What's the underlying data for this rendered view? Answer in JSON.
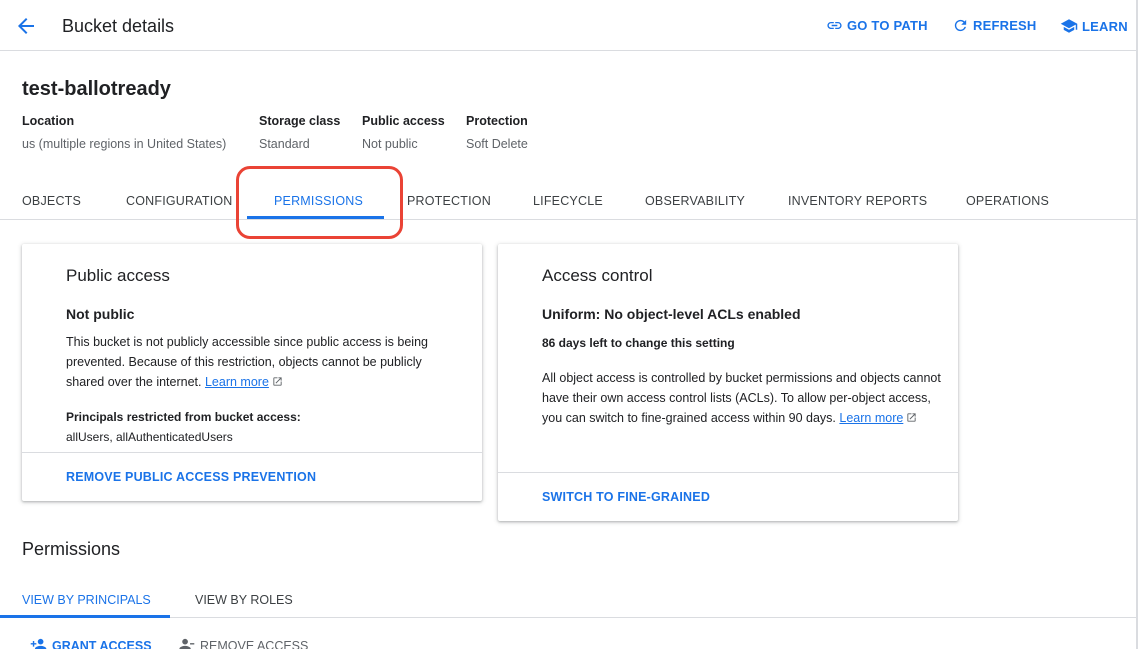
{
  "header": {
    "title": "Bucket details",
    "actions": {
      "go_to_path": "GO TO PATH",
      "refresh": "REFRESH",
      "learn": "LEARN"
    }
  },
  "bucket": {
    "name": "test-ballotready",
    "meta": [
      {
        "label": "Location",
        "value": "us (multiple regions in United States)"
      },
      {
        "label": "Storage class",
        "value": "Standard"
      },
      {
        "label": "Public access",
        "value": "Not public"
      },
      {
        "label": "Protection",
        "value": "Soft Delete"
      }
    ]
  },
  "tabs": [
    "OBJECTS",
    "CONFIGURATION",
    "PERMISSIONS",
    "PROTECTION",
    "LIFECYCLE",
    "OBSERVABILITY",
    "INVENTORY REPORTS",
    "OPERATIONS"
  ],
  "active_tab": "PERMISSIONS",
  "public_access_card": {
    "title": "Public access",
    "status": "Not public",
    "description": "This bucket is not publicly accessible since public access is being prevented. Because of this restriction, objects cannot be publicly shared over the internet.",
    "learn_more": "Learn more",
    "restricted_label": "Principals restricted from bucket access:",
    "restricted_value": "allUsers, allAuthenticatedUsers",
    "action": "REMOVE PUBLIC ACCESS PREVENTION"
  },
  "access_control_card": {
    "title": "Access control",
    "status": "Uniform: No object-level ACLs enabled",
    "days_left": "86 days left to change this setting",
    "description": "All object access is controlled by bucket permissions and objects cannot have their own access control lists (ACLs). To allow per-object access, you can switch to fine-grained access within 90 days.",
    "learn_more": "Learn more",
    "action": "SWITCH TO FINE-GRAINED"
  },
  "permissions": {
    "heading": "Permissions",
    "tabs": [
      "VIEW BY PRINCIPALS",
      "VIEW BY ROLES"
    ],
    "active_tab": "VIEW BY PRINCIPALS",
    "grant_access": "GRANT ACCESS",
    "remove_access": "REMOVE ACCESS"
  },
  "colors": {
    "accent": "#1a73e8",
    "highlight": "#ea4335",
    "divider": "#dadce0",
    "muted_text": "#5f6368"
  }
}
